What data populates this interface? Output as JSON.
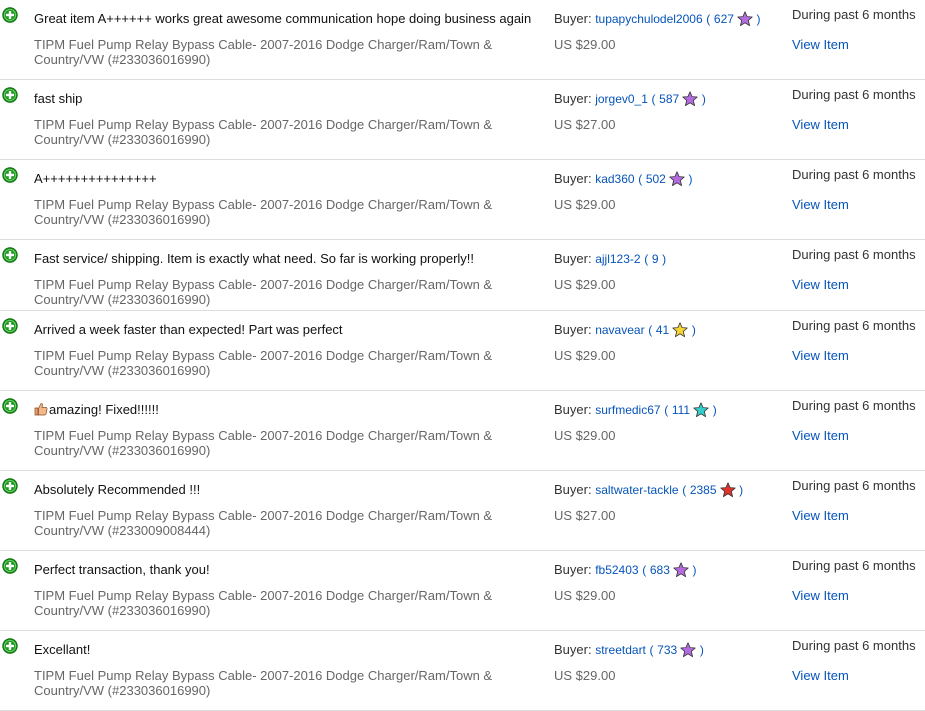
{
  "buyer_label": "Buyer:",
  "colors": {
    "purple_star": "#b46be0",
    "yellow_star": "#f5d633",
    "turquoise_star": "#34cfc8",
    "red_star": "#e0322a",
    "positive_icon": "#1a9b1a",
    "link": "#0654ba"
  },
  "entries": [
    {
      "comment": "Great item A++++++ works great awesome communication hope doing business again",
      "item": "TIPM Fuel Pump Relay Bypass Cable- 2007-2016 Dodge Charger/Ram/Town & Country/VW (#233036016990)",
      "buyer": "tupapychulodel2006",
      "score": "627",
      "star": "purple",
      "price": "US $29.00",
      "when": "During past 6 months",
      "view": "View Item"
    },
    {
      "comment": "fast ship",
      "item": "TIPM Fuel Pump Relay Bypass Cable- 2007-2016 Dodge Charger/Ram/Town & Country/VW (#233036016990)",
      "buyer": "jorgev0_1",
      "score": "587",
      "star": "purple",
      "price": "US $27.00",
      "when": "During past 6 months",
      "view": "View Item"
    },
    {
      "comment": "A+++++++++++++++",
      "item": "TIPM Fuel Pump Relay Bypass Cable- 2007-2016 Dodge Charger/Ram/Town & Country/VW (#233036016990)",
      "buyer": "kad360",
      "score": "502",
      "star": "purple",
      "price": "US $29.00",
      "when": "During past 6 months",
      "view": "View Item"
    },
    {
      "comment": "Fast service/ shipping. Item is exactly what need. So far is working properly!!",
      "item": "TIPM Fuel Pump Relay Bypass Cable- 2007-2016 Dodge Charger/Ram/Town & Country/VW (#233036016990)",
      "buyer": "ajjl123-2",
      "score": "9",
      "star": "none",
      "price": "US $29.00",
      "when": "During past 6 months",
      "view": "View Item"
    },
    {
      "comment": "Arrived a week faster than expected! Part was perfect",
      "item": "TIPM Fuel Pump Relay Bypass Cable- 2007-2016 Dodge Charger/Ram/Town & Country/VW (#233036016990)",
      "buyer": "navavear",
      "score": "41",
      "star": "yellow",
      "price": "US $29.00",
      "when": "During past 6 months",
      "view": "View Item"
    },
    {
      "comment": "amazing! Fixed!!!!!!",
      "thumb": true,
      "item": "TIPM Fuel Pump Relay Bypass Cable- 2007-2016 Dodge Charger/Ram/Town & Country/VW (#233036016990)",
      "buyer": "surfmedic67",
      "score": "111",
      "star": "turquoise",
      "price": "US $29.00",
      "when": "During past 6 months",
      "view": "View Item"
    },
    {
      "comment": "Absolutely Recommended !!!",
      "item": "TIPM Fuel Pump Relay Bypass Cable- 2007-2016 Dodge Charger/Ram/Town & Country/VW (#233009008444)",
      "buyer": "saltwater-tackle",
      "score": "2385",
      "star": "red",
      "price": "US $27.00",
      "when": "During past 6 months",
      "view": "View Item"
    },
    {
      "comment": "Perfect transaction, thank you!",
      "item": "TIPM Fuel Pump Relay Bypass Cable- 2007-2016 Dodge Charger/Ram/Town & Country/VW (#233036016990)",
      "buyer": "fb52403",
      "score": "683",
      "star": "purple",
      "price": "US $29.00",
      "when": "During past 6 months",
      "view": "View Item"
    },
    {
      "comment": "Excellant!",
      "item": "TIPM Fuel Pump Relay Bypass Cable- 2007-2016 Dodge Charger/Ram/Town & Country/VW (#233036016990)",
      "buyer": "streetdart",
      "score": "733",
      "star": "purple",
      "price": "US $29.00",
      "when": "During past 6 months",
      "view": "View Item"
    }
  ]
}
